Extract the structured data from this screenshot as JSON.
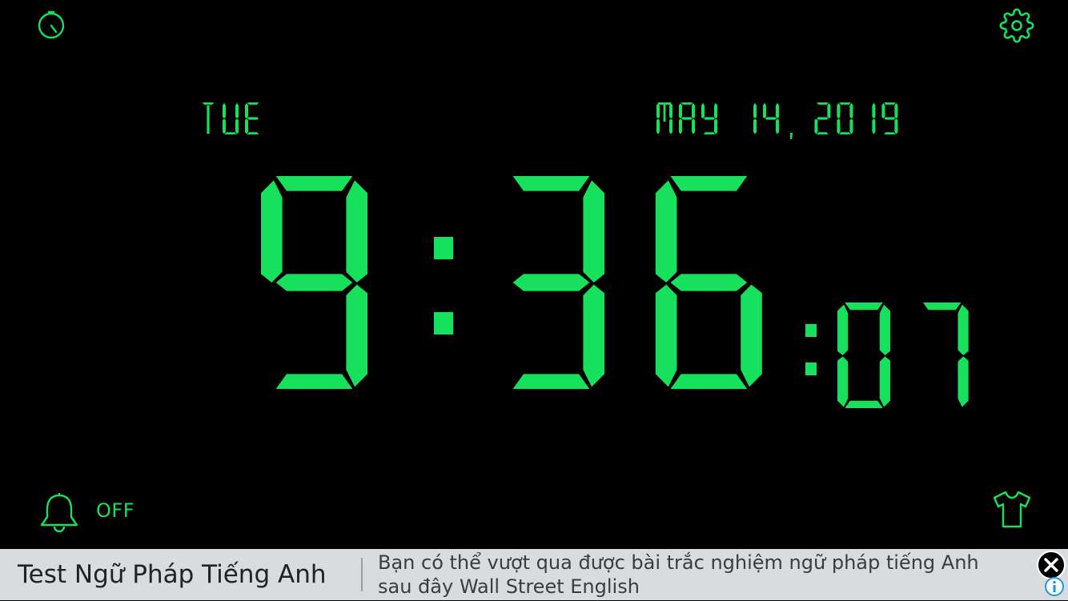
{
  "colors": {
    "digit": "#16e05c",
    "background": "#000000",
    "ad_background": "#d9dcdf"
  },
  "toolbar": {
    "timer_icon": "stopwatch-icon",
    "settings_icon": "gear-icon",
    "alarm_icon": "bell-icon",
    "theme_icon": "tshirt-icon"
  },
  "clock": {
    "weekday": "TUE",
    "date": "MAY 14, 2019",
    "hours": "9",
    "minutes": "36",
    "seconds": "07"
  },
  "alarm": {
    "status": "OFF"
  },
  "ad": {
    "title": "Test Ngữ Pháp Tiếng Anh",
    "body_line1": "Bạn có thể vượt qua được bài trắc nghiệm ngữ pháp tiếng Anh",
    "body_line2": "sau đây Wall Street English",
    "close_icon": "close-icon",
    "info_icon": "info-icon"
  }
}
